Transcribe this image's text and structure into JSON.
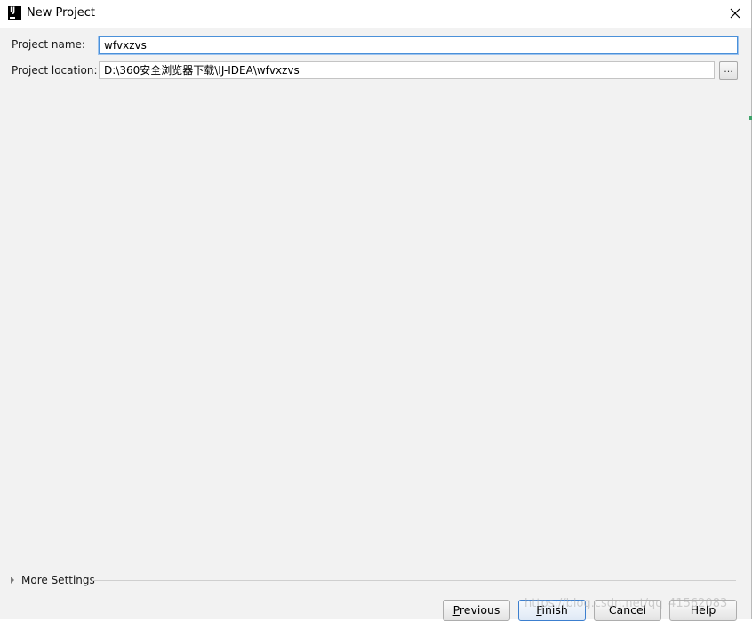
{
  "window": {
    "title": "New Project",
    "app_icon_text": "IJ"
  },
  "form": {
    "project_name_label": "Project name:",
    "project_name_value": "wfvxzvs",
    "project_location_label": "Project location:",
    "project_location_value": "D:\\360安全浏览器下载\\IJ-IDEA\\wfvxzvs",
    "browse_label": "..."
  },
  "more_settings": {
    "label": "More Settings"
  },
  "buttons": {
    "previous": "Previous",
    "finish": "Finish",
    "cancel": "Cancel",
    "help": "Help"
  },
  "watermark": "https://blog.csdn.net/qq_41562083",
  "colors": {
    "focus_border": "#4a90d9",
    "dialog_background": "#f2f2f2"
  }
}
